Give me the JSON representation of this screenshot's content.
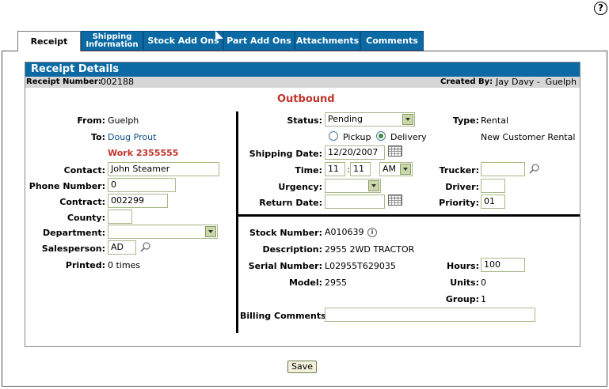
{
  "tabs": [
    {
      "label": "Receipt"
    },
    {
      "label_line1": "Shipping",
      "label_line2": "Information"
    },
    {
      "label": "Stock Add Ons"
    },
    {
      "label": "Part Add Ons"
    },
    {
      "label": "Attachments"
    },
    {
      "label": "Comments"
    }
  ],
  "header": {
    "title": "Receipt Details",
    "receipt_number_label": "Receipt Number:",
    "receipt_number": "002188",
    "created_by_label": "Created By:",
    "created_by": "Jay Davy -  Guelph"
  },
  "direction": "Outbound",
  "left": {
    "from_label": "From:",
    "from": "Guelph",
    "to_label": "To:",
    "to": "Doug Prout",
    "work_order": "Work 2355555",
    "contact_label": "Contact:",
    "contact": "John Steamer",
    "phone_label": "Phone Number:",
    "phone": "0",
    "contract_label": "Contract:",
    "contract": "002299",
    "county_label": "County:",
    "county": "",
    "department_label": "Department:",
    "department": "",
    "salesperson_label": "Salesperson:",
    "salesperson": "AD",
    "printed_label": "Printed:",
    "printed": "0 times"
  },
  "shipping": {
    "status_label": "Status:",
    "status": "Pending",
    "pickup_label": "Pickup",
    "delivery_label": "Delivery",
    "shipping_date_label": "Shipping Date:",
    "shipping_date": "12/20/2007",
    "time_label": "Time:",
    "time_hour": "11",
    "time_minute": "11",
    "time_ampm": "AM",
    "urgency_label": "Urgency:",
    "urgency": "",
    "return_date_label": "Return Date:",
    "return_date": "",
    "type_label": "Type:",
    "type": "Rental",
    "type_note": "New Customer Rental",
    "trucker_label": "Trucker:",
    "trucker": "",
    "driver_label": "Driver:",
    "driver": "",
    "priority_label": "Priority:",
    "priority": "01"
  },
  "stock": {
    "stock_number_label": "Stock Number:",
    "stock_number": "A010639",
    "description_label": "Description:",
    "description": "2955 2WD TRACTOR",
    "serial_label": "Serial Number:",
    "serial": "L02955T629035",
    "model_label": "Model:",
    "model": "2955",
    "hours_label": "Hours:",
    "hours": "100",
    "units_label": "Units:",
    "units": "0",
    "group_label": "Group:",
    "group": "1",
    "billing_label": "Billing Comments:",
    "billing": ""
  },
  "save_label": "Save",
  "icons": {
    "help": "help-icon",
    "calendar": "calendar-icon",
    "search": "magnifier-icon",
    "info": "info-icon"
  }
}
